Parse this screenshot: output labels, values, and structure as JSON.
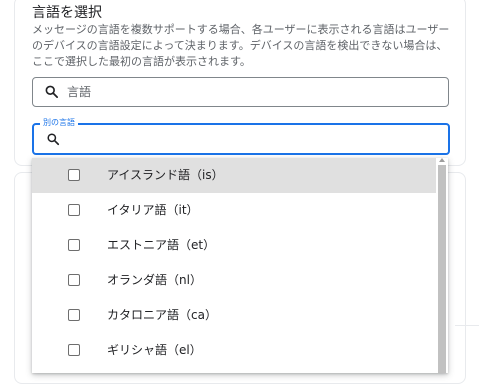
{
  "section": {
    "title": "言語を選択",
    "description": "メッセージの言語を複数サポートする場合、各ユーザーに表示される言語はユーザーのデバイスの言語設定によって決まります。デバイスの言語を検出できない場合は、ここで選択した最初の言語が表示されます。"
  },
  "language_search": {
    "placeholder": "言語",
    "value": "",
    "icon": "search-icon"
  },
  "alternate_language": {
    "label": "別の言語",
    "value": "",
    "icon": "search-icon"
  },
  "dropdown": {
    "options": [
      {
        "label": "アイスランド語（is）",
        "checked": false,
        "highlighted": true
      },
      {
        "label": "イタリア語（it）",
        "checked": false,
        "highlighted": false
      },
      {
        "label": "エストニア語（et）",
        "checked": false,
        "highlighted": false
      },
      {
        "label": "オランダ語（nl）",
        "checked": false,
        "highlighted": false
      },
      {
        "label": "カタロニア語（ca）",
        "checked": false,
        "highlighted": false
      },
      {
        "label": "ギリシャ語（el）",
        "checked": false,
        "highlighted": false
      }
    ]
  },
  "colors": {
    "accent": "#1a73e8",
    "highlight": "#e0e0e0",
    "secondary_text": "#5f6368"
  }
}
